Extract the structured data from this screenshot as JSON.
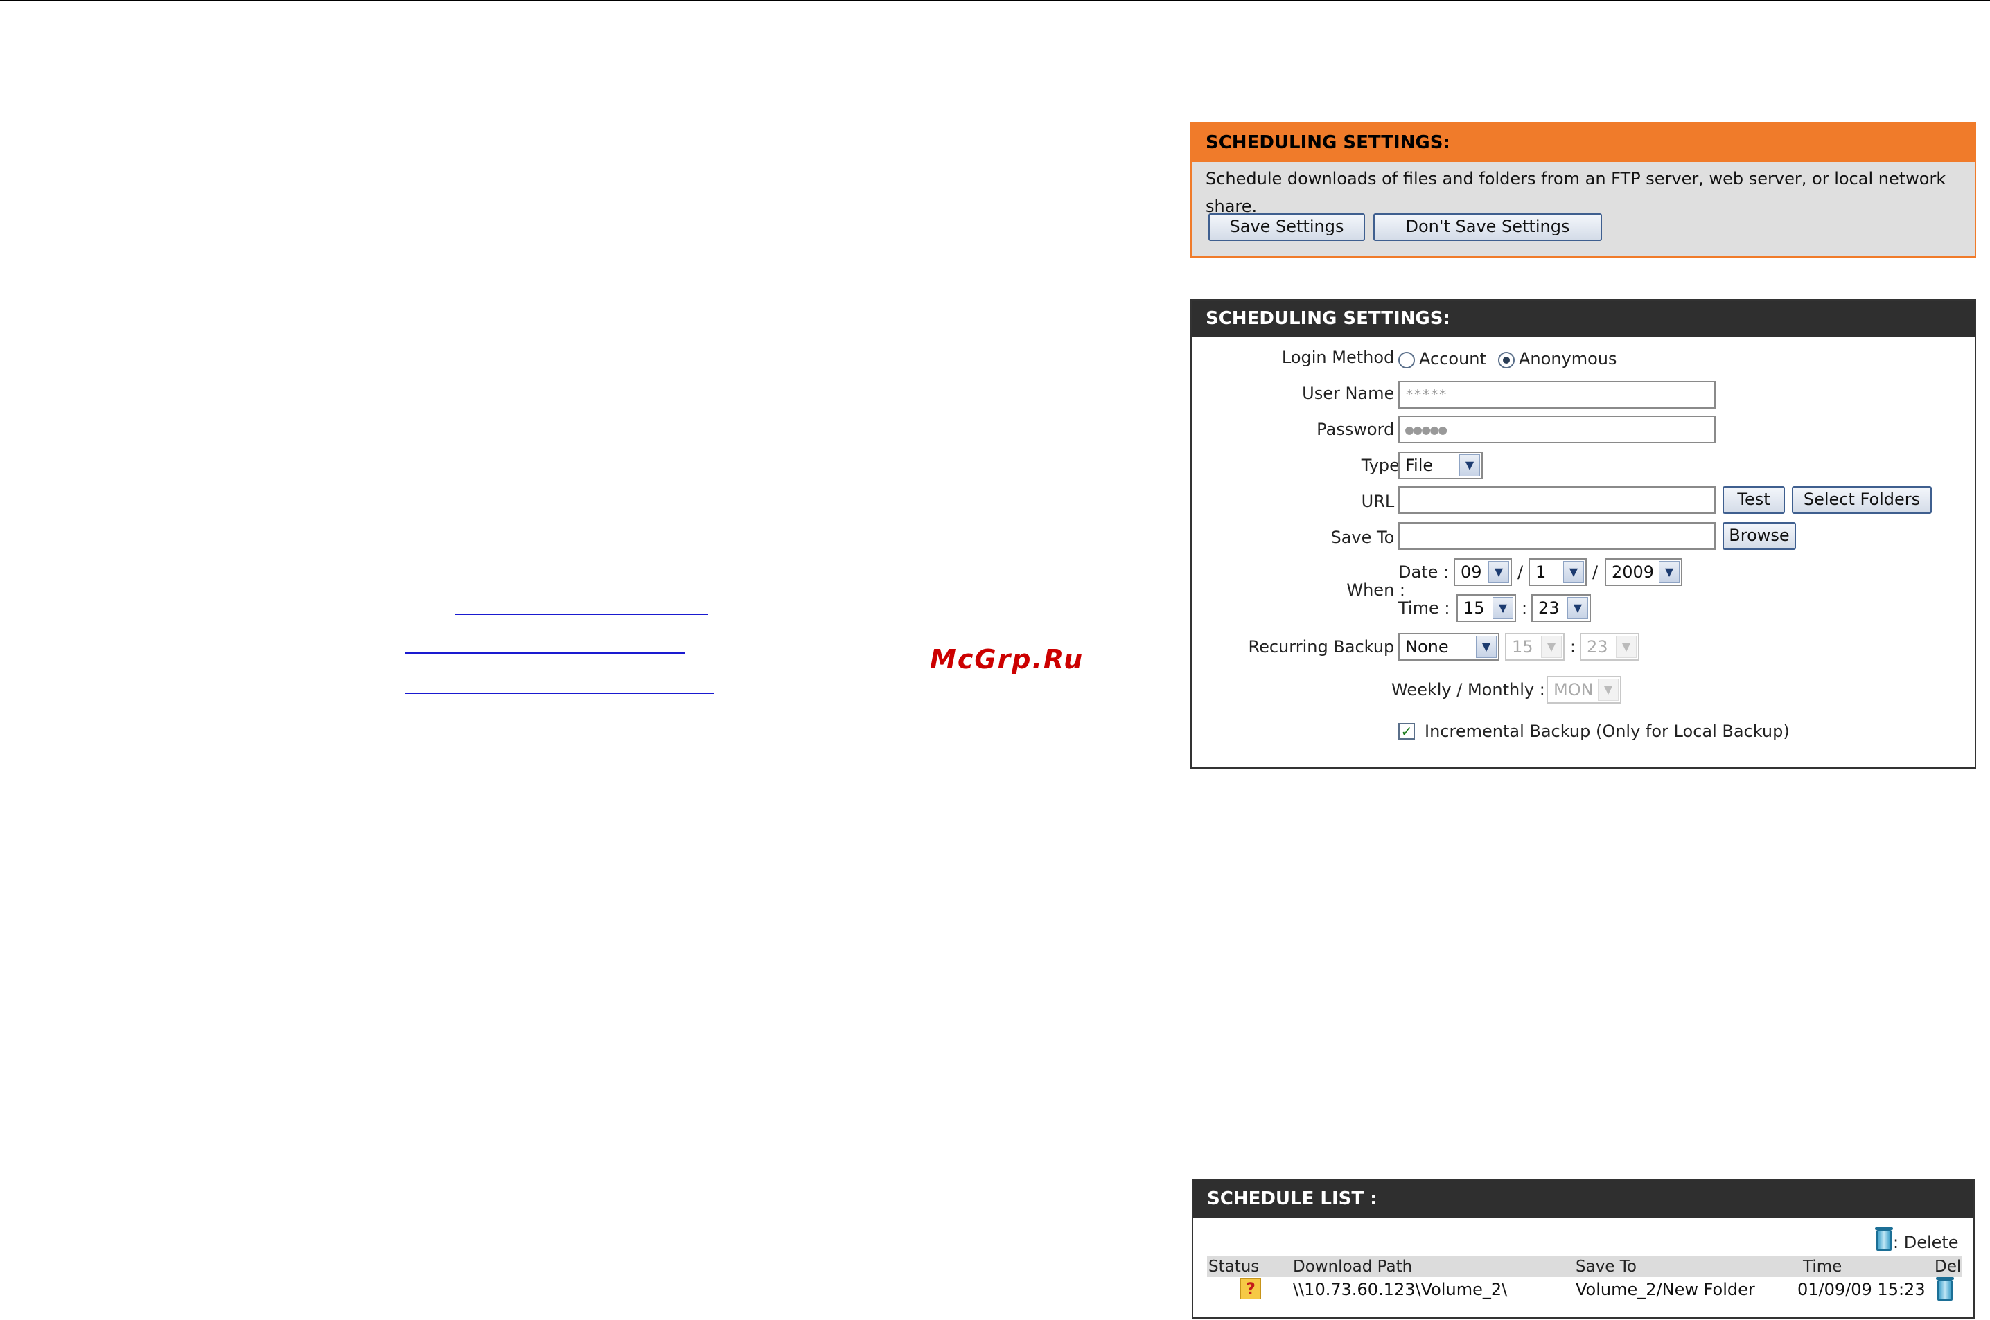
{
  "watermark": "McGrp.Ru",
  "panel1": {
    "title": "SCHEDULING SETTINGS:",
    "description": "Schedule downloads of files and folders from an FTP server, web server, or local network share.",
    "save_label": "Save Settings",
    "dont_save_label": "Don't Save Settings"
  },
  "panel2": {
    "title": "SCHEDULING SETTINGS:",
    "login_method_label": "Login Method :",
    "account_label": "Account",
    "anonymous_label": "Anonymous",
    "login_method_selected": "Anonymous",
    "username_label": "User Name :",
    "username_value": "*****",
    "password_label": "Password :",
    "password_value": "●●●●●",
    "type_label": "Type:",
    "type_value": "File",
    "url_label": "URL :",
    "url_value": "",
    "test_label": "Test",
    "select_folders_label": "Select Folders",
    "saveto_label": "Save To :",
    "saveto_value": "",
    "browse_label": "Browse",
    "when_label": "When :",
    "date_label": "Date :",
    "date_month": "09",
    "date_day": "1",
    "date_year": "2009",
    "slash": "/",
    "time_label": "Time :",
    "time_hour": "15",
    "time_minute": "23",
    "colon": ":",
    "recurring_label": "Recurring Backup :",
    "recurring_value": "None",
    "recurring_hour": "15",
    "recurring_minute": "23",
    "weekly_label": "Weekly / Monthly :",
    "weekly_value": "MON",
    "incremental_label": "Incremental Backup (Only for Local Backup)",
    "incremental_checked": true
  },
  "panel3": {
    "title": "SCHEDULE LIST :",
    "delete_legend": ": Delete",
    "columns": [
      "Status",
      "Download Path",
      "Save To",
      "Time",
      "Del"
    ],
    "rows": [
      {
        "status": "?",
        "path": "\\\\10.73.60.123\\Volume_2\\",
        "save_to": "Volume_2/New Folder",
        "time": "01/09/09 15:23"
      }
    ]
  }
}
